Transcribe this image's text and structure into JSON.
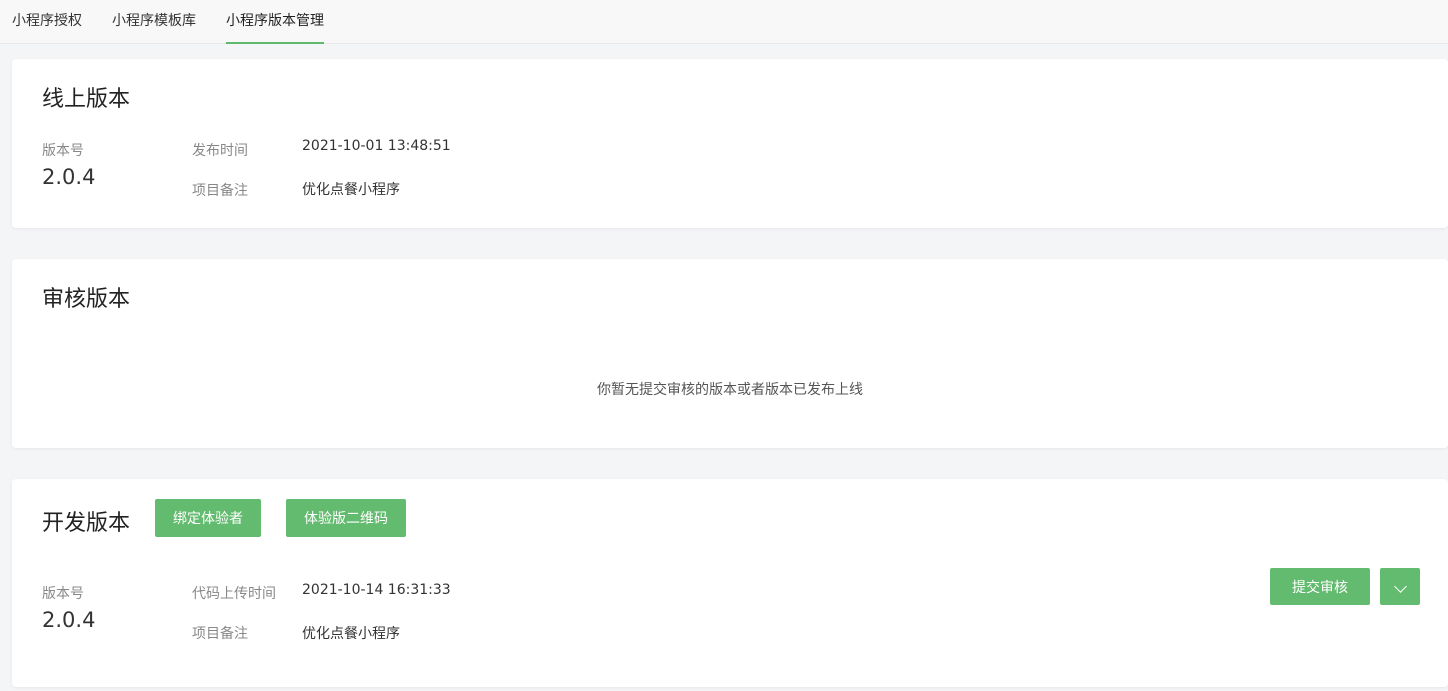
{
  "tabs": [
    {
      "label": "小程序授权"
    },
    {
      "label": "小程序模板库"
    },
    {
      "label": "小程序版本管理"
    }
  ],
  "online": {
    "title": "线上版本",
    "version_label": "版本号",
    "version": "2.0.4",
    "time_label": "发布时间",
    "time": "2021-10-01 13:48:51",
    "note_label": "项目备注",
    "note": "优化点餐小程序"
  },
  "review": {
    "title": "审核版本",
    "empty_text": "你暂无提交审核的版本或者版本已发布上线"
  },
  "dev": {
    "title": "开发版本",
    "bind_button": "绑定体验者",
    "qr_button": "体验版二维码",
    "version_label": "版本号",
    "version": "2.0.4",
    "time_label": "代码上传时间",
    "time": "2021-10-14 16:31:33",
    "note_label": "项目备注",
    "note": "优化点餐小程序",
    "submit_button": "提交审核"
  },
  "colors": {
    "accent": "#63bb6f"
  }
}
